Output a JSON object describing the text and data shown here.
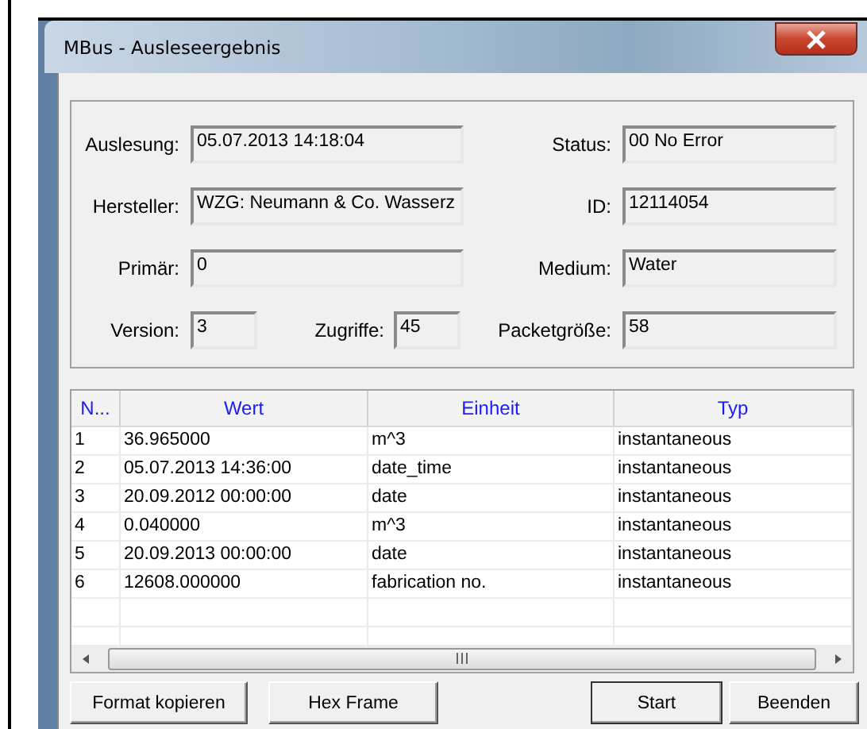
{
  "window": {
    "title": "MBus - Ausleseergebnis"
  },
  "fields": {
    "reading": {
      "label": "Auslesung:",
      "value": "05.07.2013 14:18:04"
    },
    "status": {
      "label": "Status:",
      "value": "00 No Error"
    },
    "manufacturer": {
      "label": "Hersteller:",
      "value": "WZG: Neumann & Co. Wasserz"
    },
    "id": {
      "label": "ID:",
      "value": "12114054"
    },
    "primary": {
      "label": "Primär:",
      "value": "0"
    },
    "medium": {
      "label": "Medium:",
      "value": "Water"
    },
    "version": {
      "label": "Version:",
      "value": "3"
    },
    "accesses": {
      "label": "Zugriffe:",
      "value": "45"
    },
    "packet_size": {
      "label": "Packetgröße:",
      "value": "58"
    }
  },
  "table": {
    "columns": [
      "N...",
      "Wert",
      "Einheit",
      "Typ"
    ],
    "rows": [
      [
        "1",
        "36.965000",
        "m^3",
        "instantaneous"
      ],
      [
        "2",
        "05.07.2013 14:36:00",
        "date_time",
        "instantaneous"
      ],
      [
        "3",
        "20.09.2012 00:00:00",
        "date",
        "instantaneous"
      ],
      [
        "4",
        "0.040000",
        "m^3",
        "instantaneous"
      ],
      [
        "5",
        "20.09.2013 00:00:00",
        "date",
        "instantaneous"
      ],
      [
        "6",
        "12608.000000",
        "fabrication no.",
        "instantaneous"
      ]
    ]
  },
  "buttons": [
    "Format kopieren",
    "Hex Frame",
    "Start",
    "Beenden"
  ]
}
